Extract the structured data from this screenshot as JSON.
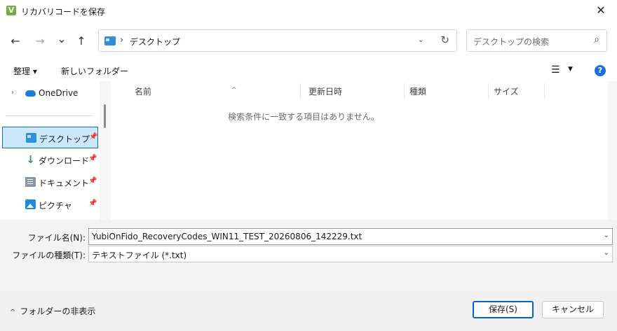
{
  "window": {
    "title": "リカバリコードを保存",
    "app_icon_glyph": "V",
    "close_glyph": "✕"
  },
  "nav": {
    "back_glyph": "←",
    "forward_glyph": "→",
    "recent_glyph": "⌄",
    "up_glyph": "↑",
    "address_separator": "›",
    "address_path": "デスクトップ",
    "address_dropdown_glyph": "⌄",
    "refresh_glyph": "↻",
    "search_placeholder": "デスクトップの検索",
    "search_glyph": "⌕"
  },
  "toolbar": {
    "organize_label": "整理 ▾",
    "new_folder_label": "新しいフォルダー",
    "view_glyph": "☰",
    "view_arrow": "▼",
    "help_glyph": "?"
  },
  "sidebar": {
    "items": [
      {
        "label": "OneDrive",
        "icon": "cloud-icon",
        "chevron": "›"
      },
      {
        "label": "デスクトップ",
        "icon": "desktop-icon",
        "pin": "📌",
        "selected": true
      },
      {
        "label": "ダウンロード",
        "icon": "download-icon",
        "pin": "📌",
        "glyph": "↓"
      },
      {
        "label": "ドキュメント",
        "icon": "document-icon",
        "pin": "📌"
      },
      {
        "label": "ピクチャ",
        "icon": "pictures-icon",
        "pin": "📌"
      }
    ]
  },
  "content": {
    "columns": [
      "名前",
      "更新日時",
      "種類",
      "サイズ"
    ],
    "sort_glyph": "^",
    "empty_message": "検索条件に一致する項目はありません。"
  },
  "file": {
    "name_label": "ファイル名(N):",
    "name_value": "YubiOnFido_RecoveryCodes_WIN11_TEST_20260806_142229.txt",
    "type_label": "ファイルの種類(T):",
    "type_value": "テキストファイル (*.txt)",
    "dropdown_glyph": "⌄"
  },
  "footer": {
    "hide_folders_glyph": "^",
    "hide_folders_label": "フォルダーの非表示",
    "save_label": "保存(S)",
    "cancel_label": "キャンセル"
  },
  "colors": {
    "accent": "#0067c0",
    "selection_bg": "#cce8ff",
    "app_icon": "#6db33f"
  }
}
